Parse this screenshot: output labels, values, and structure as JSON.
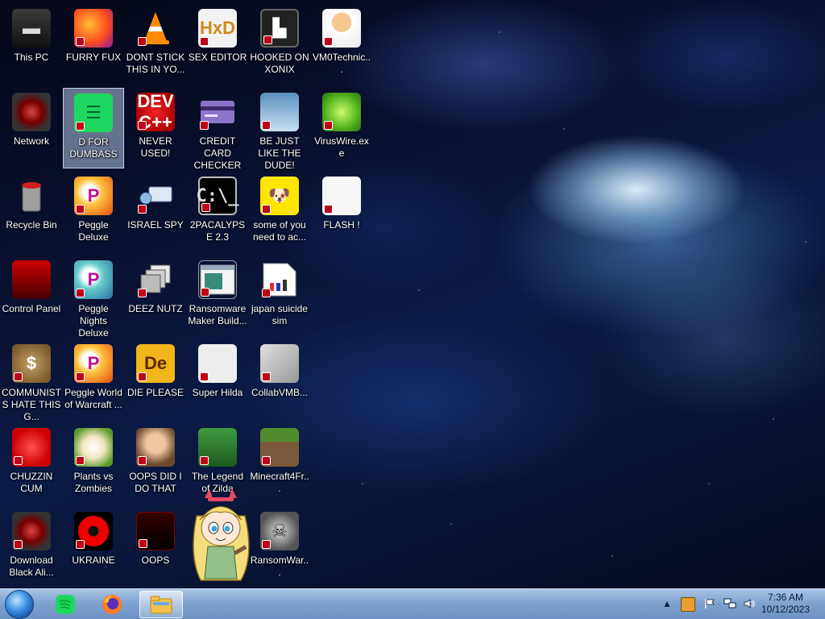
{
  "desktop": {
    "icons": [
      {
        "id": "this-pc",
        "label": "This PC"
      },
      {
        "id": "furry-fux",
        "label": "FURRY FUX"
      },
      {
        "id": "dont-stick",
        "label": "DONT STICK THIS IN YO..."
      },
      {
        "id": "sex-editor",
        "label": "SEX EDITOR"
      },
      {
        "id": "hooked-on-xonix",
        "label": "HOOKED ON XONIX"
      },
      {
        "id": "vm0technic",
        "label": "VM0Technic..."
      },
      {
        "id": "network",
        "label": "Network"
      },
      {
        "id": "d-for-dumbass",
        "label": "D FOR DUMBASS"
      },
      {
        "id": "never-used",
        "label": "NEVER USED!"
      },
      {
        "id": "credit-card-checker",
        "label": "CREDIT CARD CHECKER"
      },
      {
        "id": "be-just-like-the-dude",
        "label": "BE JUST LIKE THE DUDE!"
      },
      {
        "id": "viruswire",
        "label": "VirusWire.exe"
      },
      {
        "id": "recycle-bin",
        "label": "Recycle Bin"
      },
      {
        "id": "peggle-deluxe",
        "label": "Peggle Deluxe"
      },
      {
        "id": "israel-spy",
        "label": "ISRAEL SPY"
      },
      {
        "id": "2pacalypse",
        "label": "2PACALYPSE 2.3"
      },
      {
        "id": "some-of-you",
        "label": "some of you need to ac..."
      },
      {
        "id": "flash",
        "label": "FLASH !"
      },
      {
        "id": "control-panel",
        "label": "Control Panel"
      },
      {
        "id": "peggle-nights",
        "label": "Peggle Nights Deluxe"
      },
      {
        "id": "deez-nutz",
        "label": "DEEZ NUTZ"
      },
      {
        "id": "ransomware-maker",
        "label": "Ransomware Maker Build..."
      },
      {
        "id": "japan-suicide-sim",
        "label": "japan suicide sim"
      },
      {
        "id": "communists",
        "label": "COMMUNISTS HATE THIS G..."
      },
      {
        "id": "peggle-world",
        "label": "Peggle World of Warcraft ..."
      },
      {
        "id": "die-please",
        "label": "DIE PLEASE"
      },
      {
        "id": "super-hilda",
        "label": "Super Hilda"
      },
      {
        "id": "collabvmb",
        "label": "CollabVMB..."
      },
      {
        "id": "chuzzin-cum",
        "label": "CHUZZIN CUM"
      },
      {
        "id": "plants-vs-zombies",
        "label": "Plants vs Zombies"
      },
      {
        "id": "oops-did-i",
        "label": "OOPS DID I DO THAT"
      },
      {
        "id": "legend-of-zilda",
        "label": "The Legend of Zilda"
      },
      {
        "id": "minecraft4fr",
        "label": "Minecraft4Fr..."
      },
      {
        "id": "download-black-ali",
        "label": "Download Black Ali..."
      },
      {
        "id": "ukraine",
        "label": "UKRAINE"
      },
      {
        "id": "oops",
        "label": "OOPS"
      },
      {
        "id": "ransomwar",
        "label": "RansomWar..."
      }
    ],
    "glyphs": {
      "this-pc": "▬",
      "furry-fux": "",
      "dont-stick": "",
      "sex-editor": "HxD",
      "hooked-on-xonix": "▙",
      "vm0technic": "",
      "network": "",
      "d-for-dumbass": "☰",
      "never-used": "DEV C++",
      "credit-card-checker": "▭",
      "be-just-like-the-dude": "",
      "viruswire": "",
      "recycle-bin": "",
      "peggle-deluxe": "P",
      "israel-spy": "",
      "2pacalypse": "C:\\_",
      "some-of-you": "🐶",
      "flash": "",
      "control-panel": "",
      "peggle-nights": "P",
      "deez-nutz": "",
      "ransomware-maker": "",
      "japan-suicide-sim": "",
      "communists": "$",
      "peggle-world": "P",
      "die-please": "De",
      "super-hilda": "",
      "collabvmb": "",
      "chuzzin-cum": "",
      "plants-vs-zombies": "",
      "oops-did-i": "",
      "legend-of-zilda": "",
      "minecraft4fr": "",
      "download-black-ali": "",
      "ukraine": "",
      "oops": "",
      "ransomwar": "☠"
    },
    "selected_icon": "d-for-dumbass"
  },
  "taskbar": {
    "start_label": "Start",
    "pinned": [
      {
        "id": "spotify",
        "name": "spotify-icon"
      },
      {
        "id": "firefox",
        "name": "firefox-icon"
      },
      {
        "id": "explorer",
        "name": "file-explorer-icon",
        "active": true
      }
    ],
    "tray": {
      "chevron": "▲",
      "clock_time": "7:36 AM",
      "clock_date": "10/12/2023"
    }
  }
}
